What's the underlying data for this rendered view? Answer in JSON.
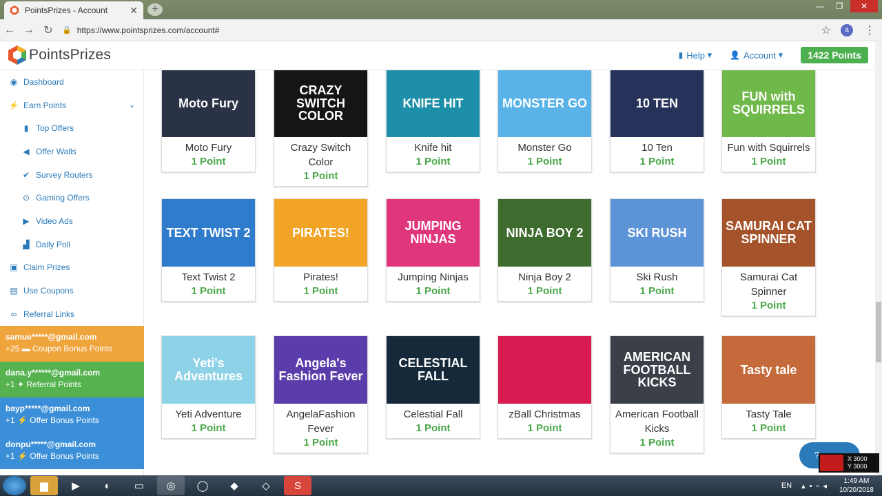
{
  "browser": {
    "tab_title": "PointsPrizes - Account",
    "tab_close": "✕",
    "new_tab": "+",
    "url": "https://www.pointsprizes.com/account#",
    "profile_initial": "a"
  },
  "site": {
    "logo_text": "PointsPrizes",
    "nav": {
      "help": "Help",
      "account": "Account",
      "points": "1422 Points"
    }
  },
  "sidebar": {
    "items": [
      {
        "label": "Dashboard",
        "icon": "dashboard-icon",
        "glyph": "◉"
      },
      {
        "label": "Earn Points",
        "icon": "bolt-icon",
        "glyph": "⚡"
      },
      {
        "label": "Top Offers",
        "icon": "bookmark-icon",
        "glyph": "▮"
      },
      {
        "label": "Offer Walls",
        "icon": "megaphone-icon",
        "glyph": "◀"
      },
      {
        "label": "Survey Routers",
        "icon": "check-circle-icon",
        "glyph": "✔"
      },
      {
        "label": "Gaming Offers",
        "icon": "gamepad-icon",
        "glyph": "⊙"
      },
      {
        "label": "Video Ads",
        "icon": "play-circle-icon",
        "glyph": "▶"
      },
      {
        "label": "Daily Poll",
        "icon": "chart-icon",
        "glyph": "▟"
      },
      {
        "label": "Claim Prizes",
        "icon": "gift-icon",
        "glyph": "▣"
      },
      {
        "label": "Use Coupons",
        "icon": "ticket-icon",
        "glyph": "▤"
      },
      {
        "label": "Referral Links",
        "icon": "link-icon",
        "glyph": "🔗"
      }
    ],
    "feed": [
      {
        "email": "samue*****@gmail.com",
        "detail": "+25 ▬ Coupon Bonus Points",
        "color": "#f0a43c"
      },
      {
        "email": "dana.y******@gmail.com",
        "detail": "+1 ✦ Referral Points",
        "color": "#55b24f"
      },
      {
        "email": "bayp*****@gmail.com",
        "detail": "+1 ⚡ Offer Bonus Points",
        "color": "#3b8fd8"
      },
      {
        "email": "donpu*****@gmail.com",
        "detail": "+1 ⚡ Offer Bonus Points",
        "color": "#3b8fd8"
      }
    ]
  },
  "games": [
    {
      "name": "Moto Fury",
      "points": "1 Point",
      "thumb_text": "Moto Fury",
      "bg": "#2a3346"
    },
    {
      "name": "Crazy Switch Color",
      "points": "1 Point",
      "thumb_text": "CRAZY SWITCH COLOR",
      "bg": "#151515"
    },
    {
      "name": "Knife hit",
      "points": "1 Point",
      "thumb_text": "KNIFE HIT",
      "bg": "#1e8fa8"
    },
    {
      "name": "Monster Go",
      "points": "1 Point",
      "thumb_text": "MONSTER GO",
      "bg": "#5ab3e6"
    },
    {
      "name": "10 Ten",
      "points": "1 Point",
      "thumb_text": "10 TEN",
      "bg": "#27325a"
    },
    {
      "name": "Fun with Squirrels",
      "points": "1 Point",
      "thumb_text": "FUN with SQUIRRELS",
      "bg": "#6fb84a"
    },
    {
      "name": "Text Twist 2",
      "points": "1 Point",
      "thumb_text": "TEXT TWIST 2",
      "bg": "#2f7ccc"
    },
    {
      "name": "Pirates!",
      "points": "1 Point",
      "thumb_text": "PIRATES!",
      "bg": "#f2a427"
    },
    {
      "name": "Jumping Ninjas",
      "points": "1 Point",
      "thumb_text": "JUMPING NINJAS",
      "bg": "#e0377c"
    },
    {
      "name": "Ninja Boy 2",
      "points": "1 Point",
      "thumb_text": "NINJA BOY 2",
      "bg": "#3e6b2e"
    },
    {
      "name": "Ski Rush",
      "points": "1 Point",
      "thumb_text": "SKI RUSH",
      "bg": "#5d94d8"
    },
    {
      "name": "Samurai Cat Spinner",
      "points": "1 Point",
      "thumb_text": "SAMURAI CAT SPINNER",
      "bg": "#a4532a"
    },
    {
      "name": "Yeti Adventure",
      "points": "1 Point",
      "thumb_text": "Yeti's Adventures",
      "bg": "#8ed2e8"
    },
    {
      "name": "AngelaFashion Fever",
      "points": "1 Point",
      "thumb_text": "Angela's Fashion Fever",
      "bg": "#5a3caa"
    },
    {
      "name": "Celestial Fall",
      "points": "1 Point",
      "thumb_text": "CELESTIAL FALL",
      "bg": "#16293a"
    },
    {
      "name": "zBall Christmas",
      "points": "1 Point",
      "thumb_text": "",
      "bg": "#d81b50"
    },
    {
      "name": "American Football Kicks",
      "points": "1 Point",
      "thumb_text": "AMERICAN FOOTBALL KICKS",
      "bg": "#3a3f48"
    },
    {
      "name": "Tasty Tale",
      "points": "1 Point",
      "thumb_text": "Tasty tale",
      "bg": "#c56a3a"
    }
  ],
  "overlay": {
    "x_label": "X 3000",
    "y_label": "Y 3000"
  },
  "taskbar": {
    "lang": "EN",
    "time": "1:49 AM",
    "date": "10/20/2018"
  }
}
